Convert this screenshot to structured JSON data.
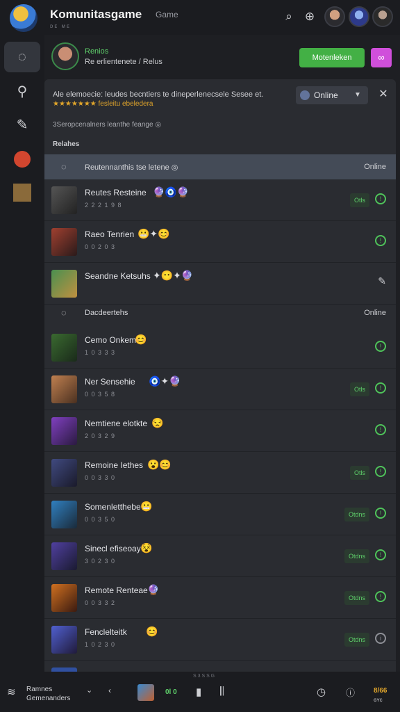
{
  "app": {
    "title": "Komunitasgame",
    "subtitle": "Game",
    "meta": "ᴅᴇ  ᴍᴇ"
  },
  "header": {
    "icons": [
      "search-icon",
      "zoom-icon"
    ],
    "avatars": [
      "user-avatar-1",
      "user-avatar-2",
      "user-avatar-3"
    ]
  },
  "rail": {
    "items": [
      {
        "name": "chat-icon",
        "glyph": "💬"
      },
      {
        "name": "search-icon",
        "glyph": "⚲"
      },
      {
        "name": "edit-icon",
        "glyph": "✎"
      },
      {
        "name": "avatar-icon",
        "glyph": "●"
      },
      {
        "name": "map-icon",
        "glyph": "▦"
      }
    ]
  },
  "profile": {
    "name": "Renios",
    "status": "Re erlientenete / Relus",
    "primary_button": "Motenleken",
    "secondary_button_icon": "link-icon"
  },
  "panel": {
    "notice": "Ale elemoecie: leudes becntiers te dineperlenecsele Sesee et.",
    "notice_stars": "★★★★★★★ fesleitu ebeledera",
    "status_select": {
      "value": "Online"
    },
    "subnote": "3Seropcenalners leanthe feange ◎",
    "section_label": "Relahes",
    "groups": [
      {
        "name": "Reutennanthis tse letene ◎",
        "status": "Online",
        "rows": [
          {
            "name": "Reutes Resteine",
            "sub": "2 2 2 1 9 8",
            "emojis": "🔮🧿🔮",
            "tag": "Otls",
            "stat": "!"
          },
          {
            "name": "Raeo Tenrien",
            "sub": "0 0 2 0 3",
            "emojis": "😬✦😊",
            "tag": "",
            "stat": "!"
          },
          {
            "name": "Seandne Ketsuhs",
            "sub": "",
            "emojis": "✦😶✦🔮",
            "tag": "",
            "stat": "edit"
          }
        ]
      },
      {
        "name": "Dacdeertehs",
        "status": "Online",
        "rows": [
          {
            "name": "Cemo Onkem",
            "sub": "1 0 3 3 3",
            "emojis": "😊",
            "tag": "",
            "stat": "!"
          },
          {
            "name": "Ner Sensehie",
            "sub": "0 0 3 5 8",
            "emojis": "🧿✦🔮",
            "tag": "Otls",
            "stat": "!"
          },
          {
            "name": "Nemtiene elotkte",
            "sub": "2 0 3 2 9",
            "emojis": "😒",
            "tag": "",
            "stat": "!"
          },
          {
            "name": "Remoine Iethes",
            "sub": "0 0 3 3 0",
            "emojis": "😮😊",
            "tag": "Otls",
            "stat": "!"
          },
          {
            "name": "Somenletthebe",
            "sub": "0 0 3 5 0",
            "emojis": "😬",
            "tag": "Otdns",
            "stat": "!"
          },
          {
            "name": "Sinecl efiseoay",
            "sub": "3 0 2 3 0",
            "emojis": "😵",
            "tag": "Otdns",
            "stat": "!"
          },
          {
            "name": "Remote Renteae",
            "sub": "0 0 3 3 2",
            "emojis": "🔮",
            "tag": "Otdns",
            "stat": "!"
          },
          {
            "name": "Fenclelteitk",
            "sub": "1 0 2 3 0",
            "emojis": "😊",
            "tag": "Otdns",
            "stat": "muted"
          }
        ]
      }
    ]
  },
  "bottom": {
    "left_line1": "Ramnes",
    "left_line2": "Gemenanders",
    "meta": "S 3 S S G",
    "center_count": "0l 0",
    "right_value": "8/66",
    "right_sub": "ɢʏᴄ"
  }
}
